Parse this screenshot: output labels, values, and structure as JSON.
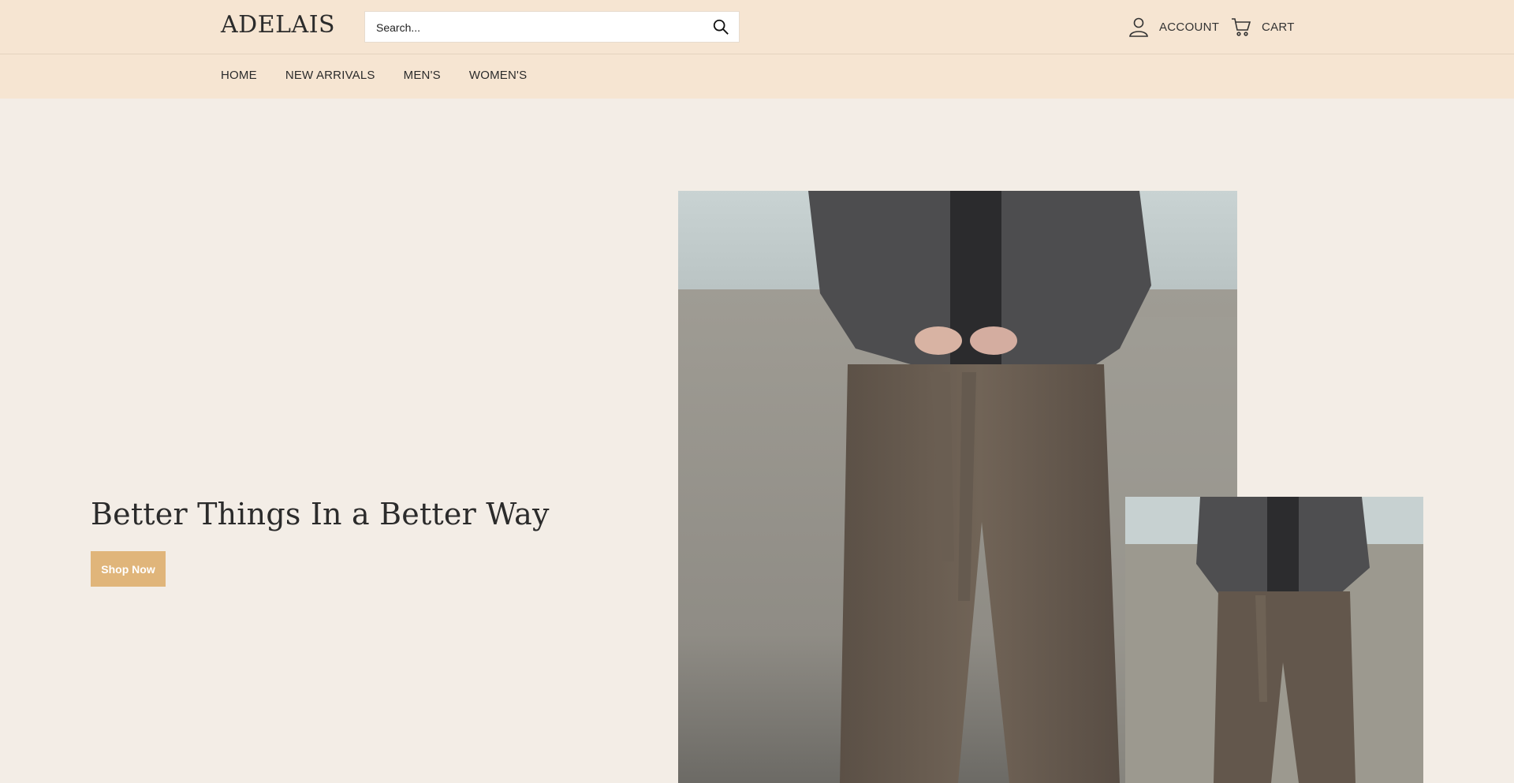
{
  "header": {
    "logo": "ADELAIS",
    "search_placeholder": "Search...",
    "account_label": "ACCOUNT",
    "cart_label": "CART"
  },
  "nav": {
    "items": [
      {
        "label": "HOME"
      },
      {
        "label": "NEW ARRIVALS"
      },
      {
        "label": "MEN'S"
      },
      {
        "label": "WOMEN'S"
      }
    ]
  },
  "hero": {
    "title": "Better Things In a Better Way",
    "cta_label": "Shop Now"
  },
  "icons": {
    "search": "search-icon",
    "account": "user-icon",
    "cart": "cart-icon"
  },
  "colors": {
    "header_bg": "#f6e5d2",
    "page_bg": "#f3ede6",
    "cta_bg": "#e0b57a"
  }
}
